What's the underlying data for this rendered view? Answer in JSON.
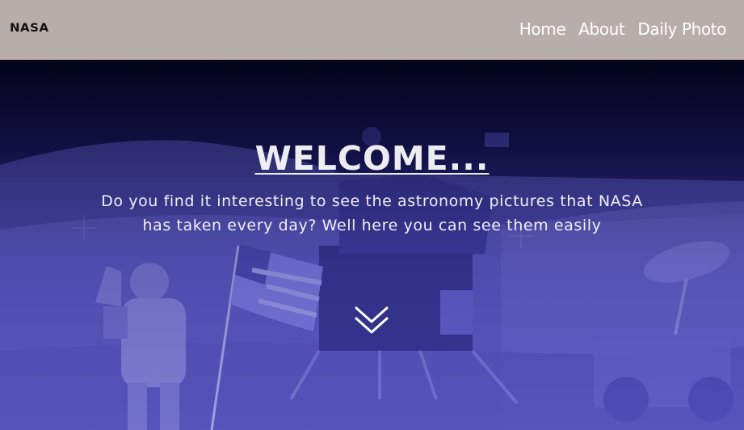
{
  "header": {
    "logo_text": "NASA",
    "nav": [
      {
        "label": "Home"
      },
      {
        "label": "About"
      },
      {
        "label": "Daily Photo"
      }
    ]
  },
  "hero": {
    "title": "WELCOME...",
    "subtitle": "Do you find it interesting to see the astronomy pictures that NASA has taken every day? Well here you can see them easily",
    "scroll_icon": "double-chevron-down-icon",
    "background_image": "apollo-astronaut-saluting-flag-on-moon"
  },
  "colors": {
    "header_bg": "#b7aeac",
    "nav_text": "#ffffff",
    "hero_tint": "#3a38a8"
  }
}
